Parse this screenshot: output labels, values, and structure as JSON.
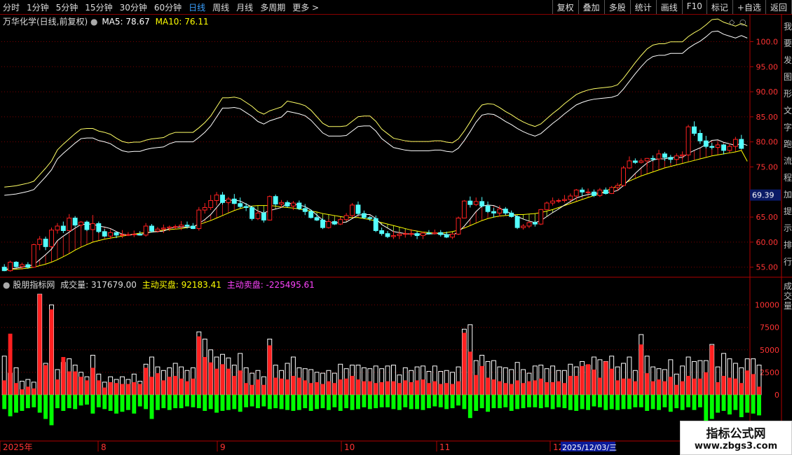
{
  "toolbar": {
    "periods": [
      "分时",
      "1分钟",
      "5分钟",
      "15分钟",
      "30分钟",
      "60分钟",
      "日线",
      "周线",
      "月线",
      "多周期",
      "更多"
    ],
    "active_period": "日线",
    "more_arrow": ">",
    "right_buttons": [
      "复权",
      "叠加",
      "多股",
      "统计",
      "画线",
      "F10",
      "标记",
      "+自选",
      "返回"
    ]
  },
  "price_panel": {
    "stock_title": "万华化学(日线,前复权)",
    "ma5_label": "MA5: 78.67",
    "ma10_label": "MA10: 76.11",
    "price_axis": [
      "100.0",
      "95.00",
      "90.00",
      "85.00",
      "80.00",
      "75.00",
      "65.00",
      "60.00",
      "55.00"
    ],
    "cursor_price": "69.39",
    "right_edge_glyphs": [
      "我",
      "要",
      "发",
      "图",
      "形",
      "文",
      "字",
      "跑",
      "流",
      "程",
      "加",
      "提",
      "示",
      "排",
      "行"
    ]
  },
  "volume_panel": {
    "indicator_title": "股朋指标网",
    "volume_label": "成交量: 317679.00",
    "buy_label": "主动买盘: 92183.41",
    "sell_label": "主动卖盘: -225495.61",
    "volume_axis": [
      "10000",
      "7500",
      "5000",
      "2500",
      "0"
    ],
    "right_edge_glyphs": [
      "成",
      "交",
      "量"
    ]
  },
  "date_axis": {
    "labels": [
      "2025年",
      "8",
      "9",
      "10",
      "11",
      "12"
    ],
    "cursor_date": "2025/12/03/三"
  },
  "watermark": {
    "name": "指标公式网",
    "url": "www.zbgs3.com"
  },
  "colors": {
    "up": "#ff2020",
    "down": "#54ffff",
    "ma5": "#ffffff",
    "ma10": "#ffff00",
    "buy": "#ff2020",
    "sell": "#00ff00",
    "grid": "#7a0000",
    "active": "#3aa0ff"
  },
  "chart_data": {
    "type": "candlestick",
    "ma5_last": 78.67,
    "ma10_last": 76.11,
    "price_range": [
      53,
      103
    ],
    "volume_range": [
      -5000,
      12000
    ],
    "candles": [
      [
        55.0,
        55.6,
        54.2,
        54.3
      ],
      [
        54.3,
        56.3,
        54.1,
        56.0
      ],
      [
        56.0,
        56.2,
        54.9,
        55.1
      ],
      [
        55.1,
        55.9,
        54.5,
        55.5
      ],
      [
        55.5,
        56.0,
        54.7,
        55.0
      ],
      [
        55.0,
        59.7,
        54.9,
        59.5
      ],
      [
        59.5,
        61.2,
        58.4,
        60.6
      ],
      [
        60.6,
        61.1,
        58.4,
        59.1
      ],
      [
        59.1,
        62.9,
        58.7,
        62.4
      ],
      [
        62.4,
        63.8,
        61.7,
        63.2
      ],
      [
        63.2,
        64.1,
        61.8,
        62.3
      ],
      [
        62.3,
        65.6,
        62.2,
        64.8
      ],
      [
        64.8,
        65.2,
        63.0,
        63.4
      ],
      [
        63.4,
        64.2,
        62.9,
        64.0
      ],
      [
        64.0,
        64.3,
        62.2,
        62.5
      ],
      [
        62.5,
        65.4,
        62.4,
        63.7
      ],
      [
        63.7,
        64.1,
        61.8,
        62.1
      ],
      [
        62.1,
        62.6,
        61.0,
        61.2
      ],
      [
        61.2,
        62.1,
        60.6,
        61.9
      ],
      [
        61.9,
        62.0,
        60.8,
        61.4
      ],
      [
        61.4,
        62.4,
        60.8,
        61.5
      ],
      [
        61.5,
        62.0,
        61.2,
        61.5
      ],
      [
        61.5,
        62.3,
        61.0,
        61.6
      ],
      [
        61.6,
        62.2,
        61.3,
        61.4
      ],
      [
        61.4,
        63.8,
        61.1,
        63.2
      ],
      [
        63.2,
        63.6,
        61.9,
        62.2
      ],
      [
        62.2,
        63.0,
        61.9,
        62.6
      ],
      [
        62.6,
        63.5,
        61.8,
        62.8
      ],
      [
        62.8,
        63.3,
        62.2,
        63.0
      ],
      [
        63.0,
        63.5,
        62.6,
        63.1
      ],
      [
        63.1,
        64.2,
        62.4,
        63.4
      ],
      [
        63.4,
        64.1,
        62.7,
        63.2
      ],
      [
        63.2,
        63.8,
        62.6,
        62.7
      ],
      [
        62.7,
        67.0,
        62.3,
        66.4
      ],
      [
        66.4,
        67.8,
        65.7,
        66.9
      ],
      [
        66.9,
        69.4,
        66.4,
        68.3
      ],
      [
        68.3,
        70.0,
        67.3,
        69.4
      ],
      [
        69.4,
        70.0,
        67.5,
        67.9
      ],
      [
        67.9,
        69.0,
        67.5,
        68.6
      ],
      [
        68.6,
        69.6,
        67.6,
        67.7
      ],
      [
        67.7,
        68.9,
        66.8,
        67.1
      ],
      [
        67.1,
        67.8,
        66.2,
        66.9
      ],
      [
        66.9,
        67.2,
        64.3,
        64.7
      ],
      [
        64.7,
        66.3,
        64.4,
        65.8
      ],
      [
        65.8,
        66.3,
        63.9,
        64.4
      ],
      [
        64.4,
        69.3,
        64.3,
        69.1
      ],
      [
        69.1,
        69.5,
        67.2,
        67.6
      ],
      [
        67.6,
        68.4,
        66.9,
        67.9
      ],
      [
        67.9,
        68.3,
        66.9,
        67.2
      ],
      [
        67.2,
        68.2,
        66.4,
        67.8
      ],
      [
        67.8,
        68.3,
        66.4,
        66.7
      ],
      [
        66.7,
        67.6,
        65.4,
        66.1
      ],
      [
        66.1,
        66.5,
        64.7,
        64.9
      ],
      [
        64.9,
        65.6,
        64.2,
        64.4
      ],
      [
        64.4,
        64.8,
        62.6,
        62.9
      ],
      [
        62.9,
        64.6,
        62.7,
        64.1
      ],
      [
        64.1,
        64.4,
        63.4,
        63.6
      ],
      [
        63.6,
        64.9,
        63.4,
        64.5
      ],
      [
        64.5,
        65.8,
        64.2,
        65.3
      ],
      [
        65.3,
        67.8,
        64.9,
        67.4
      ],
      [
        67.4,
        68.1,
        65.4,
        65.7
      ],
      [
        65.7,
        66.3,
        64.6,
        64.9
      ],
      [
        64.9,
        65.2,
        64.2,
        64.7
      ],
      [
        64.7,
        65.3,
        62.0,
        62.3
      ],
      [
        62.3,
        62.9,
        61.3,
        61.7
      ],
      [
        61.7,
        62.2,
        60.8,
        61.1
      ],
      [
        61.1,
        62.2,
        60.6,
        61.3
      ],
      [
        61.3,
        62.1,
        60.6,
        61.6
      ],
      [
        61.6,
        62.3,
        60.9,
        61.7
      ],
      [
        61.7,
        62.6,
        61.1,
        61.7
      ],
      [
        61.7,
        62.1,
        60.6,
        61.3
      ],
      [
        61.3,
        62.1,
        60.6,
        61.8
      ],
      [
        61.8,
        62.4,
        61.5,
        61.7
      ],
      [
        61.7,
        62.5,
        61.5,
        61.9
      ],
      [
        61.9,
        62.4,
        61.1,
        61.5
      ],
      [
        61.5,
        62.1,
        60.8,
        61.0
      ],
      [
        61.0,
        61.8,
        60.6,
        61.6
      ],
      [
        61.6,
        65.1,
        61.4,
        64.8
      ],
      [
        64.8,
        68.4,
        64.8,
        68.2
      ],
      [
        68.2,
        69.1,
        66.9,
        67.5
      ],
      [
        67.5,
        68.9,
        67.2,
        68.1
      ],
      [
        68.1,
        69.0,
        66.9,
        67.2
      ],
      [
        67.2,
        68.1,
        65.8,
        66.1
      ],
      [
        66.1,
        66.8,
        64.9,
        65.8
      ],
      [
        65.8,
        67.3,
        65.1,
        66.6
      ],
      [
        66.6,
        67.0,
        65.4,
        65.8
      ],
      [
        65.8,
        66.3,
        64.9,
        65.1
      ],
      [
        65.1,
        65.3,
        62.6,
        62.9
      ],
      [
        62.9,
        63.6,
        62.5,
        63.2
      ],
      [
        63.2,
        64.2,
        62.8,
        63.9
      ],
      [
        63.9,
        64.3,
        63.1,
        63.6
      ],
      [
        63.6,
        66.6,
        63.4,
        66.5
      ],
      [
        66.5,
        68.1,
        66.4,
        67.8
      ],
      [
        67.8,
        68.9,
        67.3,
        68.2
      ],
      [
        68.2,
        68.7,
        67.8,
        68.3
      ],
      [
        68.3,
        69.4,
        67.9,
        68.5
      ],
      [
        68.5,
        69.7,
        68.2,
        69.2
      ],
      [
        69.2,
        70.6,
        68.7,
        70.4
      ],
      [
        70.4,
        70.9,
        69.2,
        70.0
      ],
      [
        70.0,
        70.7,
        69.6,
        70.0
      ],
      [
        70.0,
        70.5,
        69.0,
        69.3
      ],
      [
        69.3,
        70.8,
        69.0,
        70.4
      ],
      [
        70.4,
        70.9,
        69.5,
        69.7
      ],
      [
        69.7,
        71.2,
        69.6,
        70.9
      ],
      [
        70.9,
        71.8,
        70.2,
        71.3
      ],
      [
        71.3,
        75.2,
        71.1,
        74.8
      ],
      [
        74.8,
        77.1,
        74.6,
        76.2
      ],
      [
        76.2,
        76.7,
        75.6,
        75.9
      ],
      [
        75.9,
        76.7,
        75.7,
        76.2
      ],
      [
        76.2,
        76.8,
        75.1,
        76.7
      ],
      [
        76.7,
        77.3,
        76.1,
        76.6
      ],
      [
        76.6,
        78.4,
        76.3,
        77.6
      ],
      [
        77.6,
        78.0,
        76.2,
        76.9
      ],
      [
        76.9,
        77.4,
        75.8,
        76.5
      ],
      [
        76.5,
        77.7,
        76.3,
        77.2
      ],
      [
        77.2,
        78.1,
        76.6,
        77.4
      ],
      [
        77.4,
        83.4,
        77.2,
        83.0
      ],
      [
        83.0,
        84.1,
        81.2,
        81.7
      ],
      [
        81.7,
        82.4,
        79.6,
        80.2
      ],
      [
        80.2,
        81.2,
        78.7,
        79.1
      ],
      [
        79.1,
        79.8,
        78.5,
        78.9
      ],
      [
        78.9,
        79.9,
        78.5,
        79.4
      ],
      [
        79.4,
        79.6,
        77.5,
        78.3
      ],
      [
        78.3,
        79.7,
        77.9,
        79.1
      ],
      [
        79.1,
        81.0,
        78.7,
        80.5
      ],
      [
        80.5,
        81.4,
        78.5,
        78.7
      ]
    ],
    "ma5": [
      54.6,
      54.7,
      54.8,
      55.0,
      55.2,
      55.5,
      56.5,
      57.5,
      58.6,
      60.3,
      61.2,
      62.0,
      62.8,
      63.5,
      63.6,
      63.6,
      63.2,
      63.0,
      62.7,
      62.1,
      61.6,
      61.4,
      61.5,
      61.5,
      61.8,
      62.0,
      62.1,
      62.2,
      62.7,
      63.0,
      63.0,
      63.0,
      63.0,
      63.7,
      64.5,
      65.5,
      66.9,
      68.3,
      68.3,
      68.4,
      68.2,
      67.6,
      67.0,
      66.2,
      65.8,
      66.3,
      66.6,
      66.9,
      67.8,
      67.6,
      67.4,
      67.1,
      66.4,
      65.4,
      64.4,
      63.9,
      63.9,
      63.9,
      64.0,
      64.7,
      65.4,
      65.5,
      65.5,
      64.7,
      63.5,
      62.8,
      62.1,
      61.9,
      61.7,
      61.6,
      61.6,
      61.6,
      61.6,
      61.7,
      61.7,
      61.5,
      61.4,
      62.0,
      63.2,
      64.6,
      66.1,
      67.2,
      67.4,
      67.3,
      66.8,
      66.2,
      65.7,
      65.1,
      64.6,
      64.2,
      63.9,
      64.3,
      65.1,
      65.9,
      66.6,
      67.4,
      68.1,
      68.8,
      69.2,
      69.5,
      69.7,
      69.8,
      69.9,
      70.0,
      70.3,
      71.3,
      72.5,
      73.7,
      74.8,
      75.8,
      76.4,
      76.6,
      76.6,
      76.9,
      76.9,
      76.9,
      77.7,
      78.3,
      78.8,
      79.5,
      80.3,
      80.4,
      79.9,
      79.6,
      79.3,
      79.7,
      79.3
    ],
    "ma10": [
      54.5,
      54.5,
      54.6,
      54.7,
      54.8,
      55.0,
      55.3,
      55.6,
      56.0,
      56.5,
      57.1,
      57.7,
      58.4,
      59.0,
      59.5,
      60.0,
      60.3,
      60.6,
      60.8,
      61.0,
      61.2,
      61.4,
      61.6,
      61.8,
      61.9,
      62.0,
      62.2,
      62.4,
      62.5,
      62.6,
      62.7,
      62.9,
      63.1,
      63.5,
      63.9,
      64.3,
      64.8,
      65.3,
      65.8,
      66.3,
      66.7,
      67.0,
      67.2,
      67.3,
      67.3,
      67.3,
      67.2,
      67.0,
      66.9,
      66.8,
      66.6,
      66.4,
      66.2,
      66.0,
      65.7,
      65.5,
      65.3,
      65.1,
      64.9,
      64.9,
      64.9,
      64.7,
      64.5,
      64.2,
      63.9,
      63.6,
      63.3,
      63.0,
      62.7,
      62.4,
      62.2,
      62.0,
      61.9,
      61.8,
      61.8,
      61.9,
      62.1,
      62.4,
      62.8,
      63.3,
      63.8,
      64.3,
      64.7,
      65.0,
      65.2,
      65.3,
      65.4,
      65.5,
      65.5,
      65.6,
      65.7,
      65.9,
      66.2,
      66.5,
      66.9,
      67.3,
      67.7,
      68.1,
      68.5,
      68.9,
      69.3,
      69.7,
      70.2,
      70.7,
      71.2,
      71.7,
      72.2,
      72.7,
      73.2,
      73.6,
      74.0,
      74.4,
      74.8,
      75.1,
      75.4,
      75.7,
      76.0,
      76.3,
      76.6,
      76.9,
      77.2,
      77.4,
      77.6,
      77.8,
      78.0,
      78.3,
      76.11
    ],
    "volume_total": [
      4300,
      2400,
      3000,
      1500,
      1700,
      1400,
      11200,
      3500,
      10000,
      2800,
      3600,
      4000,
      3300,
      2500,
      2000,
      4400,
      2300,
      1400,
      2000,
      1700,
      2000,
      1700,
      2300,
      1500,
      3400,
      4200,
      3100,
      2700,
      3000,
      3500,
      3100,
      2700,
      3000,
      7000,
      6200,
      5000,
      4200,
      4500,
      4100,
      3300,
      4600,
      3000,
      2400,
      2700,
      2000,
      6200,
      3300,
      2700,
      3500,
      4200,
      3000,
      2900,
      2800,
      2500,
      2400,
      2700,
      2400,
      3400,
      2900,
      3300,
      3300,
      3000,
      2900,
      3200,
      2900,
      3200,
      3300,
      2200,
      3000,
      2700,
      3100,
      3200,
      2600,
      3200,
      2600,
      2700,
      2500,
      3100,
      7300,
      7800,
      3800,
      4400,
      3700,
      3800,
      3100,
      3000,
      2800,
      3600,
      2800,
      2400,
      3200,
      3300,
      2900,
      3200,
      2700,
      2700,
      3400,
      3100,
      3700,
      3300,
      4200,
      3900,
      3700,
      4300,
      3100,
      3500,
      4200,
      2700,
      6700,
      4300,
      3100,
      2900,
      2800,
      3900,
      2300,
      3200,
      4200,
      3700,
      3800,
      3800,
      5600,
      3100,
      4600,
      4000,
      3500,
      3000,
      4000,
      4000,
      3300
    ],
    "volume_buy": [
      1600,
      6800,
      1300,
      600,
      900,
      700,
      11200,
      3300,
      9500,
      1700,
      4200,
      2600,
      2600,
      2000,
      1600,
      3000,
      1600,
      800,
      1400,
      1300,
      1200,
      1200,
      1400,
      1200,
      3000,
      2000,
      2400,
      1600,
      2000,
      2100,
      1800,
      1500,
      1800,
      6500,
      4200,
      3600,
      2900,
      3400,
      2900,
      2100,
      2700,
      1300,
      1100,
      1700,
      1100,
      5500,
      1900,
      1800,
      1700,
      2100,
      1900,
      1600,
      1300,
      1400,
      1200,
      1500,
      1300,
      1700,
      1800,
      2100,
      1700,
      1500,
      1500,
      1300,
      1400,
      1500,
      1500,
      1300,
      1600,
      1400,
      1600,
      1700,
      1300,
      1500,
      1200,
      1300,
      1200,
      1500,
      6900,
      4800,
      2200,
      3200,
      1900,
      1700,
      1500,
      1300,
      1200,
      1600,
      1300,
      1500,
      1600,
      1800,
      1400,
      1400,
      1500,
      1300,
      2100,
      2100,
      3200,
      3400,
      2800,
      1900,
      3700,
      2900,
      1600,
      1800,
      1800,
      1500,
      5600,
      2400,
      1500,
      1700,
      1500,
      2000,
      1100,
      1500,
      2100,
      1800,
      1800,
      2500,
      5500,
      1400,
      2100,
      1900,
      1800,
      1300,
      2700,
      2300,
      900
    ],
    "volume_sell": [
      -1600,
      -2400,
      -2000,
      -1800,
      -1500,
      -1400,
      -2000,
      -2700,
      -3400,
      -1500,
      -1800,
      -1500,
      -1600,
      -1200,
      -1100,
      -2100,
      -1400,
      -1600,
      -1800,
      -2100,
      -1900,
      -1700,
      -2100,
      -1300,
      -1600,
      -2700,
      -1700,
      -1500,
      -1700,
      -1500,
      -1500,
      -1300,
      -1400,
      -1500,
      -1800,
      -1600,
      -2000,
      -1800,
      -1700,
      -1600,
      -1900,
      -1400,
      -1300,
      -1500,
      -1300,
      -1600,
      -1500,
      -1600,
      -1700,
      -1800,
      -1700,
      -1500,
      -1800,
      -1600,
      -1500,
      -1700,
      -1400,
      -1800,
      -1500,
      -1700,
      -1600,
      -1400,
      -1600,
      -1500,
      -1400,
      -1400,
      -1600,
      -1700,
      -1400,
      -1600,
      -1600,
      -1700,
      -1500,
      -1300,
      -1400,
      -1600,
      -1500,
      -1200,
      -1600,
      -2600,
      -1800,
      -1500,
      -1900,
      -1500,
      -1500,
      -1400,
      -1800,
      -1600,
      -1500,
      -1400,
      -1400,
      -1500,
      -1400,
      -1600,
      -1400,
      -1500,
      -1700,
      -1800,
      -1600,
      -1700,
      -1300,
      -1400,
      -1700,
      -1600,
      -1700,
      -1600,
      -1600,
      -1400,
      -1400,
      -1800,
      -1600,
      -1700,
      -1400,
      -1900,
      -1500,
      -1700,
      -1400,
      -1700,
      -1400,
      -3200,
      -2700,
      -2000,
      -1800,
      -2200,
      -1700,
      -2500,
      -2000,
      -2100,
      -2300
    ]
  }
}
